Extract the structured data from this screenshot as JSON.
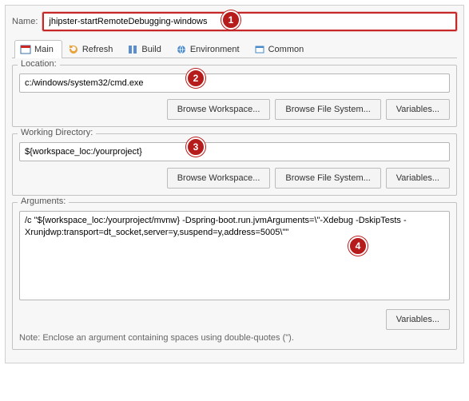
{
  "name": {
    "label": "Name:",
    "value": "jhipster-startRemoteDebugging-windows"
  },
  "tabs": {
    "main": "Main",
    "refresh": "Refresh",
    "build": "Build",
    "environment": "Environment",
    "common": "Common"
  },
  "location": {
    "label": "Location:",
    "value": "c:/windows/system32/cmd.exe",
    "browse_workspace": "Browse Workspace...",
    "browse_filesystem": "Browse File System...",
    "variables": "Variables..."
  },
  "working_dir": {
    "label": "Working Directory:",
    "value": "${workspace_loc:/yourproject}",
    "browse_workspace": "Browse Workspace...",
    "browse_filesystem": "Browse File System...",
    "variables": "Variables..."
  },
  "arguments": {
    "label": "Arguments:",
    "value": "/c \"${workspace_loc:/yourproject/mvnw} -Dspring-boot.run.jvmArguments=\\\"-Xdebug -DskipTests -Xrunjdwp:transport=dt_socket,server=y,suspend=y,address=5005\\\"\"",
    "variables": "Variables...",
    "note": "Note: Enclose an argument containing spaces using double-quotes (\")."
  },
  "callouts": {
    "c1": "1",
    "c2": "2",
    "c3": "3",
    "c4": "4"
  },
  "colors": {
    "callout_bg": "#b71c1c",
    "border_focus": "#c62828"
  }
}
